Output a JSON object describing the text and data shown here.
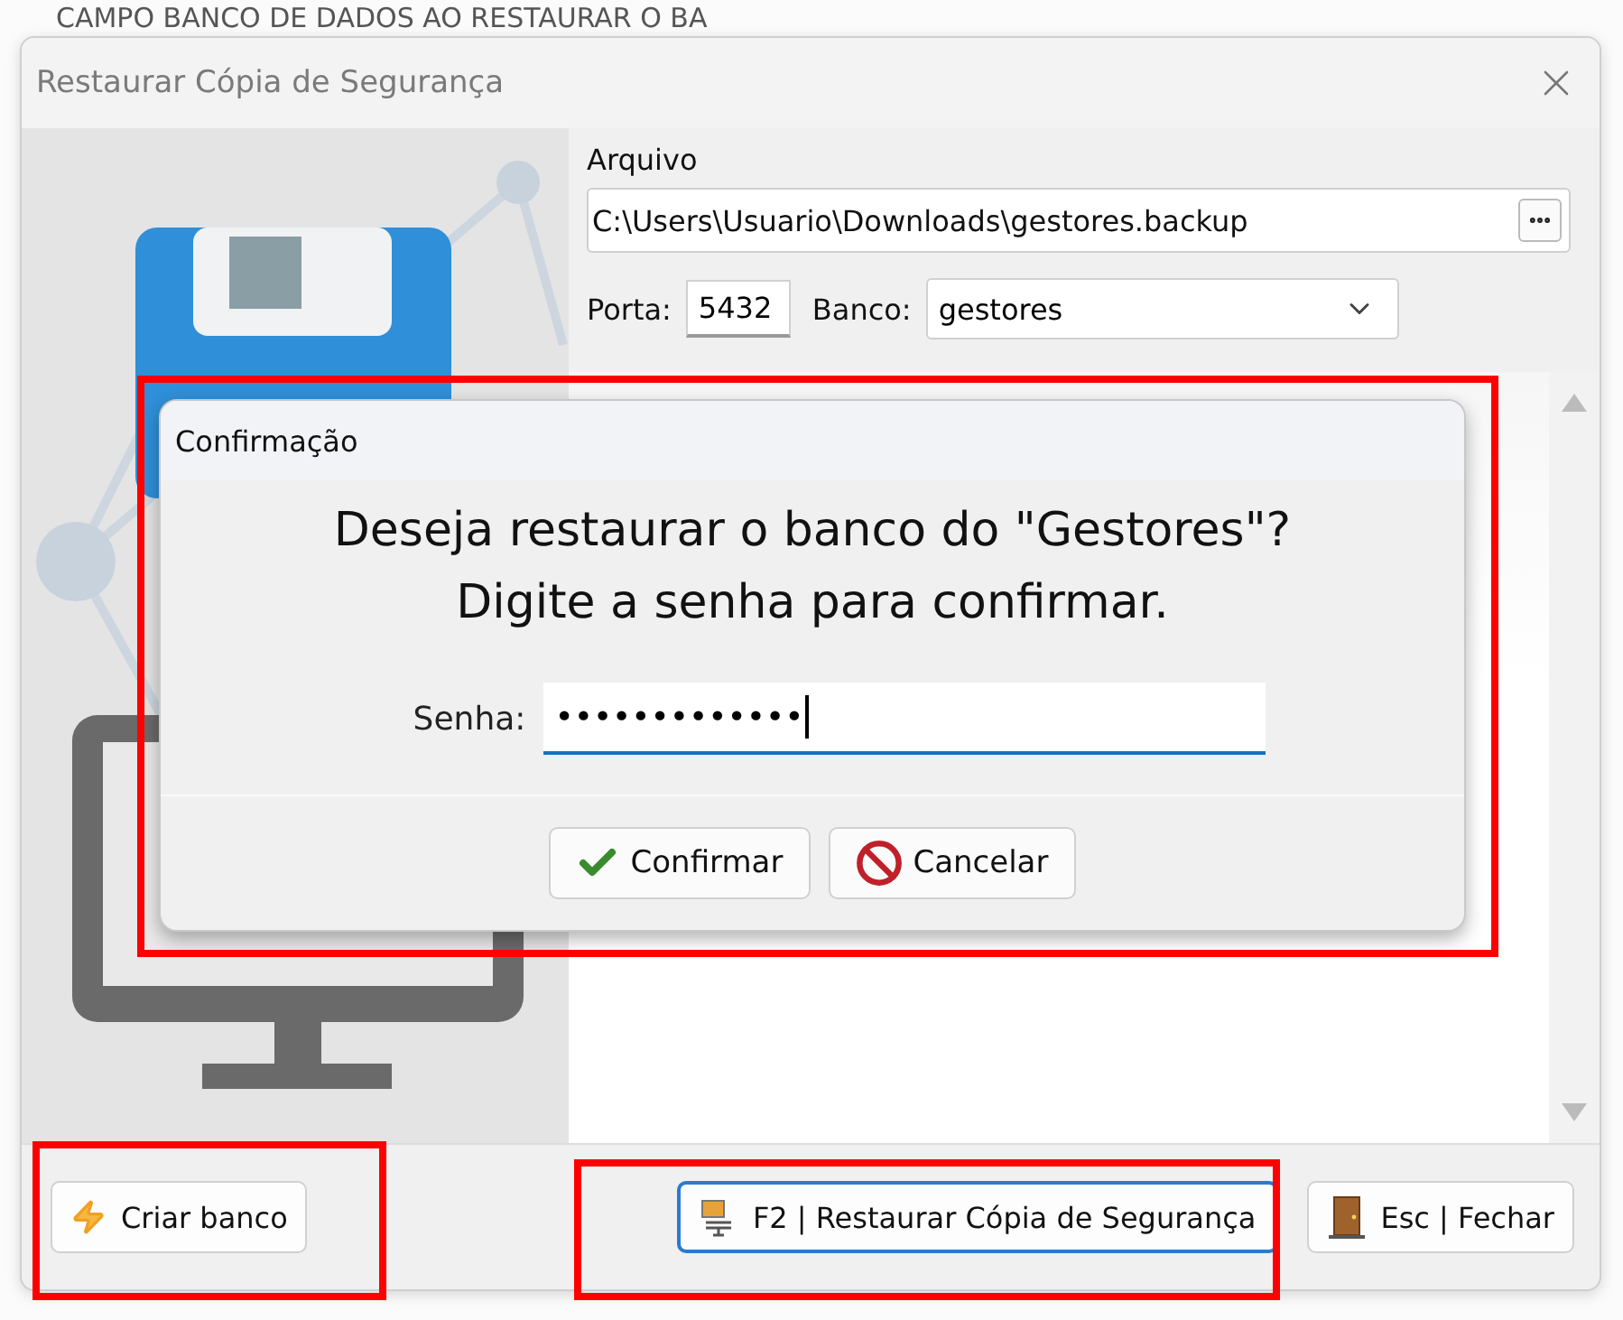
{
  "background_heading": "CAMPO BANCO DE DADOS AO RESTAURAR O BA",
  "window": {
    "title": "Restaurar Cópia de Segurança"
  },
  "file": {
    "label": "Arquivo",
    "value": "C:\\Users\\Usuario\\Downloads\\gestores.backup"
  },
  "port": {
    "label": "Porta:",
    "value": "5432"
  },
  "database": {
    "label": "Banco:",
    "value": "gestores"
  },
  "buttons": [
    {
      "label": "Criar banco",
      "kind": "create",
      "focused": false
    },
    {
      "label": "F2 | Restaurar Cópia de Segurança",
      "kind": "restore",
      "focused": true
    },
    {
      "label": "Esc | Fechar",
      "kind": "close",
      "focused": false
    }
  ],
  "dialog": {
    "title": "Confirmação",
    "message_lines": [
      "Deseja restaurar o banco do \"Gestores\"?",
      "Digite a senha para confirmar."
    ],
    "password_label": "Senha:",
    "password_value": "•••••••••••••",
    "buttons": [
      {
        "label": "Confirmar",
        "kind": "confirm"
      },
      {
        "label": "Cancelar",
        "kind": "cancel"
      }
    ]
  }
}
